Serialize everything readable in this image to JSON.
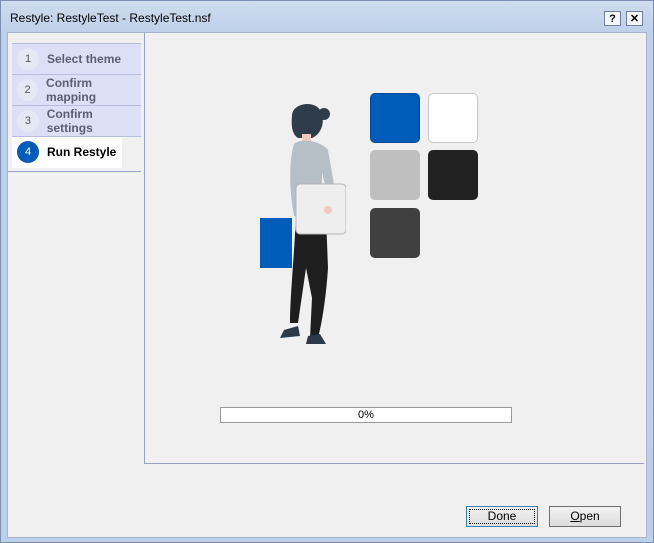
{
  "window": {
    "title": "Restyle: RestyleTest - RestyleTest.nsf"
  },
  "titlebar_buttons": {
    "help": "?",
    "close": "✕"
  },
  "steps": [
    {
      "num": "1",
      "label": "Select theme"
    },
    {
      "num": "2",
      "label": "Confirm mapping"
    },
    {
      "num": "3",
      "label": "Confirm settings"
    },
    {
      "num": "4",
      "label": "Run Restyle",
      "active": true
    }
  ],
  "swatches": [
    "#005cb9",
    "#ffffff",
    "#bfbfbf",
    "#222222",
    "#404040"
  ],
  "progress": {
    "value": 0,
    "text": "0%"
  },
  "buttons": {
    "done": "Done",
    "open_first": "O",
    "open_rest": "pen"
  }
}
